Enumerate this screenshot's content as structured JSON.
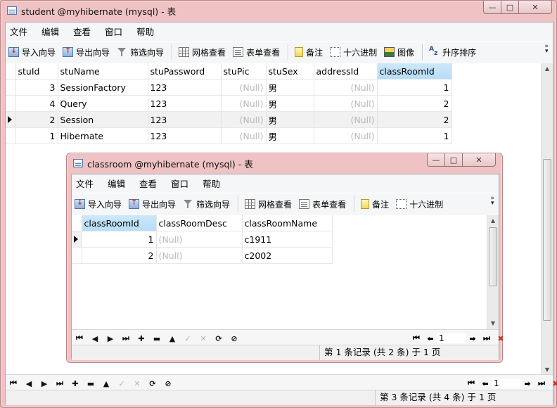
{
  "student_window": {
    "title": "student @myhibernate (mysql) - 表",
    "menu": [
      "文件",
      "编辑",
      "查看",
      "窗口",
      "帮助"
    ],
    "toolbar": {
      "import": "导入向导",
      "export": "导出向导",
      "filter": "筛选向导",
      "grid_view": "网格查看",
      "form_view": "表单查看",
      "memo": "备注",
      "hex": "十六进制",
      "image": "图像",
      "sort": "升序排序"
    },
    "columns": [
      "stuId",
      "stuName",
      "stuPassword",
      "stuPic",
      "stuSex",
      "addressId",
      "classRoomId"
    ],
    "rows": [
      [
        "3",
        "SessionFactory",
        "123",
        "(Null)",
        "男",
        "(Null)",
        "1"
      ],
      [
        "4",
        "Query",
        "123",
        "(Null)",
        "男",
        "(Null)",
        "2"
      ],
      [
        "2",
        "Session",
        "123",
        "(Null)",
        "男",
        "(Null)",
        "2"
      ],
      [
        "1",
        "Hibernate",
        "123",
        "(Null)",
        "男",
        "(Null)",
        "1"
      ]
    ],
    "page_input": "1",
    "status": "第 3 条记录 (共 4 条) 于 1 页"
  },
  "classroom_window": {
    "title": "classroom @myhibernate (mysql) - 表",
    "menu": [
      "文件",
      "编辑",
      "查看",
      "窗口",
      "帮助"
    ],
    "toolbar": {
      "import": "导入向导",
      "export": "导出向导",
      "filter": "筛选向导",
      "grid_view": "网格查看",
      "form_view": "表单查看",
      "memo": "备注",
      "hex": "十六进制"
    },
    "columns": [
      "classRoomId",
      "classRoomDesc",
      "classRoomName"
    ],
    "rows": [
      [
        "1",
        "(Null)",
        "c1911"
      ],
      [
        "2",
        "(Null)",
        "c2002"
      ]
    ],
    "page_input": "1",
    "status": "第 1 条记录 (共 2 条) 于 1 页"
  },
  "icons": {
    "nav": [
      "first-record-icon",
      "prev-record-icon",
      "next-record-icon",
      "last-record-icon",
      "add-record-icon",
      "delete-record-icon",
      "up-icon",
      "apply-icon",
      "cancel-icon",
      "refresh-icon",
      "stop-icon"
    ]
  },
  "colors": {
    "window_frame": "#efc2c4",
    "selected_header": "#b7ddf6",
    "null_text": "#b8b8b8"
  }
}
